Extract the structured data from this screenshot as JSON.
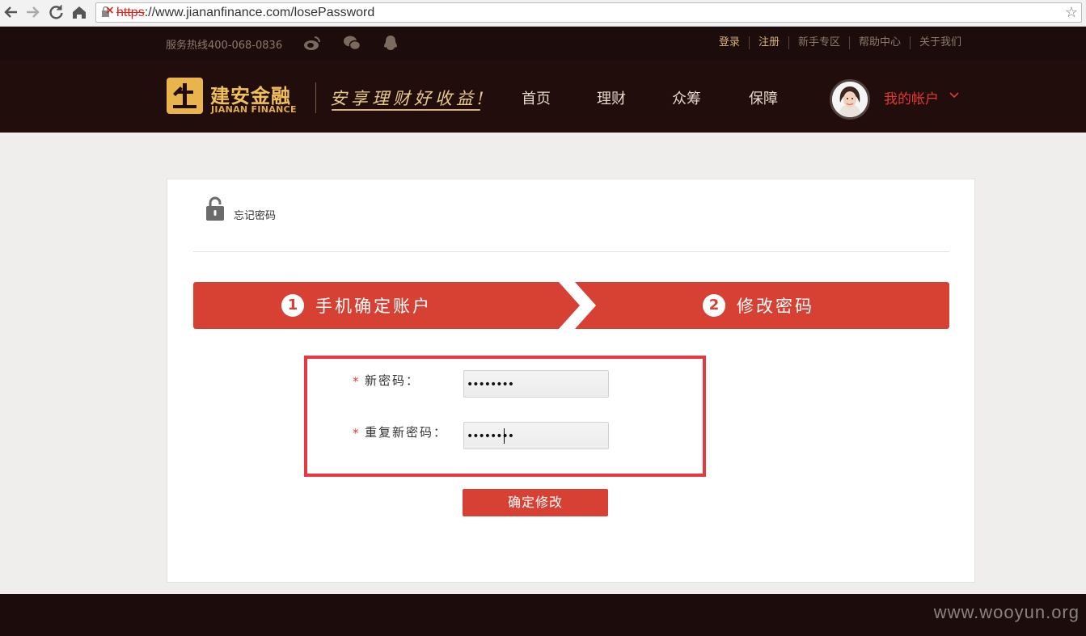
{
  "browser": {
    "url_scheme": "https",
    "url_rest": "://www.jiananfinance.com/losePassword",
    "icons": [
      "back-icon",
      "forward-icon",
      "reload-icon",
      "home-icon",
      "insecure-lock-icon",
      "bookmark-star-icon"
    ]
  },
  "topbar": {
    "hotline": "服务热线400-068-0836",
    "social_icons": [
      "weibo-icon",
      "wechat-icon",
      "qq-icon"
    ],
    "links": [
      {
        "label": "登录",
        "highlight": true
      },
      {
        "label": "注册",
        "highlight": true
      },
      {
        "label": "新手专区",
        "highlight": false
      },
      {
        "label": "帮助中心",
        "highlight": false
      },
      {
        "label": "关于我们",
        "highlight": false
      }
    ]
  },
  "header": {
    "logo_cn": "建安金融",
    "logo_en": "JIANAN FINANCE",
    "slogan": "安享理财好收益!",
    "nav": [
      "首页",
      "理财",
      "众筹",
      "保障"
    ],
    "account_label": "我的帐户"
  },
  "page": {
    "title": "忘记密码",
    "steps": [
      {
        "number": "1",
        "label": "手机确定账户"
      },
      {
        "number": "2",
        "label": "修改密码"
      }
    ],
    "form": {
      "required_mark": "*",
      "new_password_label": "新密码：",
      "new_password_value": "••••••••",
      "repeat_password_label": "重复新密码：",
      "repeat_password_value": "••••••••",
      "submit_label": "确定修改"
    }
  },
  "footer": {
    "watermark": "www.wooyun.org"
  },
  "colors": {
    "header_bg": "#210d0c",
    "topbar_bg": "#1c0c0b",
    "accent_red": "#d64133",
    "gold": "#f1c05a",
    "highlight_box": "#e8373e"
  }
}
